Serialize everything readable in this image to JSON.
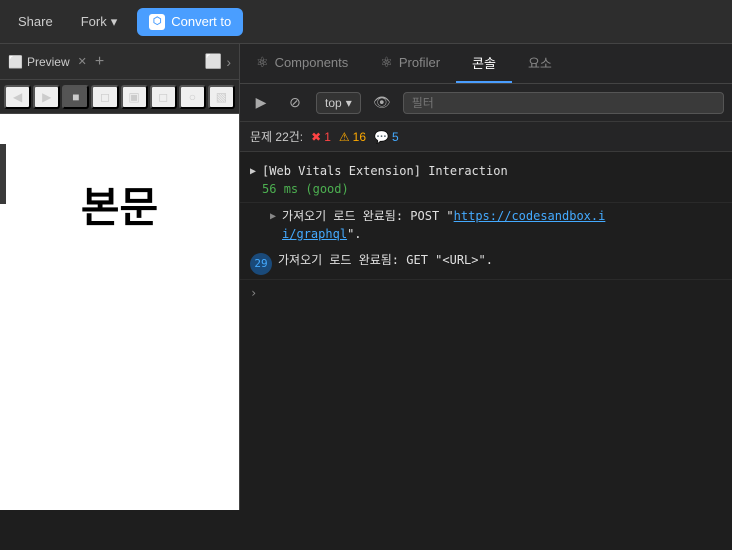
{
  "topbar": {
    "share_label": "Share",
    "fork_label": "Fork",
    "fork_chevron": "▾",
    "convert_label": "Convert to",
    "convert_icon": "⬡"
  },
  "tabs": {
    "preview_label": "Preview",
    "add_icon": "+",
    "nav_back": "‹",
    "nav_forward": "›"
  },
  "console_tabs": [
    {
      "id": "components",
      "icon": "⚛",
      "label": "Components",
      "active": false
    },
    {
      "id": "profiler",
      "icon": "⚛",
      "label": "Profiler",
      "active": false
    },
    {
      "id": "console",
      "icon": "",
      "label": "콘솔",
      "active": true
    },
    {
      "id": "elements",
      "icon": "",
      "label": "요소",
      "active": false
    }
  ],
  "console_toolbar": {
    "play_icon": "▶",
    "stop_icon": "⊘",
    "top_label": "top",
    "chevron": "▾",
    "eye_icon": "👁",
    "filter_placeholder": "필터"
  },
  "issue_bar": {
    "label": "문제 22건:",
    "error_icon": "✖",
    "error_count": "1",
    "warn_icon": "⚠",
    "warn_count": "16",
    "info_icon": "💬",
    "info_count": "5"
  },
  "log_entries": [
    {
      "id": "web-vitals",
      "expanded": true,
      "title": "[Web Vitals Extension] Interaction",
      "timing": "56 ms (good)",
      "sub_entries": [
        {
          "arrow": "▶",
          "text_before": "가져오기 로드 완료됨: POST \"",
          "url": "https://codesandbox.i/graphql",
          "text_after": "\"."
        }
      ]
    },
    {
      "id": "fetch-get",
      "badge": "29",
      "text": "가져오기 로드 완료됨: GET \"<URL>\"."
    }
  ],
  "preview": {
    "main_text": "본문",
    "toolbar_icons": [
      "◀",
      "▶",
      "■",
      "□",
      "▣",
      "□",
      "○",
      "▧"
    ]
  }
}
